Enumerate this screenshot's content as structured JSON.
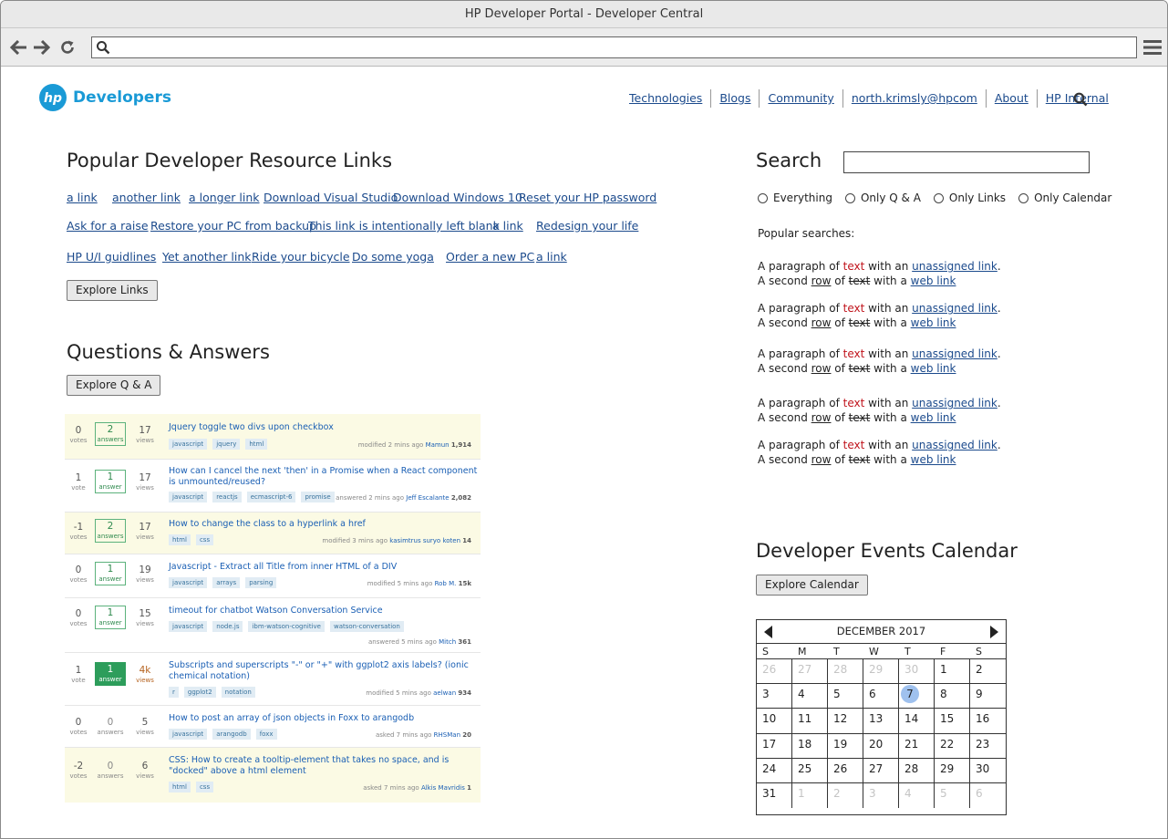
{
  "window": {
    "title": "HP Developer Portal - Developer Central"
  },
  "browser": {
    "address_value": ""
  },
  "header": {
    "logo_text": "Developers",
    "nav": [
      "Technologies",
      "Blogs",
      "Community",
      "north.krimsly@hpcom",
      "About",
      "HP Internal"
    ]
  },
  "resources": {
    "title": "Popular Developer Resource Links",
    "links": [
      "a link",
      "another link",
      "a longer link",
      "Download Visual Studio",
      "Download Windows 10",
      "Reset your HP password",
      "Ask for a raise",
      "Restore your PC from backup",
      "This link is intentionally left blank",
      "a link",
      "Redesign your life",
      "HP U/I guidlines",
      "Yet another link",
      "Ride your bicycle",
      "Do some yoga",
      "Order a new PC",
      "a link"
    ],
    "button": "Explore Links"
  },
  "qa": {
    "title": "Questions & Answers",
    "button": "Explore Q & A",
    "items": [
      {
        "votes": "0",
        "votes_label": "votes",
        "answers": "2",
        "answers_label": "answers",
        "views": "17",
        "views_label": "views",
        "title": "Jquery toggle two divs upon checkbox",
        "tags": [
          "javascript",
          "jquery",
          "html"
        ],
        "meta": "modified 2 mins ago",
        "user": "Mamun",
        "rep": "1,914"
      },
      {
        "votes": "1",
        "votes_label": "vote",
        "answers": "1",
        "answers_label": "answer",
        "views": "17",
        "views_label": "views",
        "title": "How can I cancel the next 'then' in a Promise when a React component is unmounted/reused?",
        "tags": [
          "javascript",
          "reactjs",
          "ecmascript-6",
          "promise"
        ],
        "meta": "answered 2 mins ago",
        "user": "Jeff Escalante",
        "rep": "2,082"
      },
      {
        "votes": "-1",
        "votes_label": "votes",
        "answers": "2",
        "answers_label": "answers",
        "views": "17",
        "views_label": "views",
        "title": "How to change the class to a hyperlink a href",
        "tags": [
          "html",
          "css"
        ],
        "meta": "modified 3 mins ago",
        "user": "kasimtrus suryo koten",
        "rep": "14"
      },
      {
        "votes": "0",
        "votes_label": "votes",
        "answers": "1",
        "answers_label": "answer",
        "views": "19",
        "views_label": "views",
        "title": "Javascript - Extract all Title from inner HTML of a DIV",
        "tags": [
          "javascript",
          "arrays",
          "parsing"
        ],
        "meta": "modified 5 mins ago",
        "user": "Rob M.",
        "rep": "15k"
      },
      {
        "votes": "0",
        "votes_label": "votes",
        "answers": "1",
        "answers_label": "answer",
        "views": "15",
        "views_label": "views",
        "title": "timeout for chatbot Watson Conversation Service",
        "tags": [
          "javascript",
          "node.js",
          "ibm-watson-cognitive",
          "watson-conversation"
        ],
        "meta": "answered 5 mins ago",
        "user": "Mitch",
        "rep": "361"
      },
      {
        "votes": "1",
        "votes_label": "vote",
        "answers": "1",
        "answers_label": "answer",
        "views": "4k",
        "views_label": "views",
        "title": "Subscripts and superscripts \"-\" or \"+\" with ggplot2 axis labels? (ionic chemical notation)",
        "tags": [
          "r",
          "ggplot2",
          "notation"
        ],
        "meta": "modified 5 mins ago",
        "user": "aelwan",
        "rep": "934"
      },
      {
        "votes": "0",
        "votes_label": "votes",
        "answers": "0",
        "answers_label": "answers",
        "views": "5",
        "views_label": "views",
        "title": "How to post an array of json objects in Foxx to arangodb",
        "tags": [
          "javascript",
          "arangodb",
          "foxx"
        ],
        "meta": "asked 7 mins ago",
        "user": "RHSMan",
        "rep": "20"
      },
      {
        "votes": "-2",
        "votes_label": "votes",
        "answers": "0",
        "answers_label": "answers",
        "views": "6",
        "views_label": "views",
        "title": "CSS: How to create a tooltip-element that takes no space, and is \"docked\" above a html element",
        "tags": [
          "html",
          "css"
        ],
        "meta": "asked 7 mins ago",
        "user": "Alkis Mavridis",
        "rep": "1"
      }
    ]
  },
  "search": {
    "title": "Search",
    "value": "",
    "options": [
      "Everything",
      "Only Q & A",
      "Only Links",
      "Only Calendar"
    ],
    "popular_label": "Popular searches:",
    "paragraph": {
      "a": "A paragraph of ",
      "red": "text",
      "b": " with an ",
      "link1": "unassigned link",
      "c": ".",
      "d": "A second ",
      "row": "row",
      "e": " of ",
      "strike": "text",
      "f": " with a ",
      "link2": "web link"
    }
  },
  "calendar": {
    "title": "Developer Events Calendar",
    "button": "Explore Calendar",
    "month": "DECEMBER 2017",
    "dow": [
      "S",
      "M",
      "T",
      "W",
      "T",
      "F",
      "S"
    ],
    "days": [
      "26",
      "27",
      "28",
      "29",
      "30",
      "1",
      "2",
      "3",
      "4",
      "5",
      "6",
      "7",
      "8",
      "9",
      "10",
      "11",
      "12",
      "13",
      "14",
      "15",
      "16",
      "17",
      "18",
      "19",
      "20",
      "21",
      "22",
      "23",
      "24",
      "25",
      "26",
      "27",
      "28",
      "29",
      "30",
      "31",
      "1",
      "2",
      "3",
      "4",
      "5",
      "6"
    ],
    "muted_indices": [
      0,
      1,
      2,
      3,
      4,
      36,
      37,
      38,
      39,
      40,
      41
    ],
    "today_index": 11
  },
  "colors": {
    "accent": "#1a9ad6",
    "link": "#1b4a8c",
    "highlight_text": "#c0141c",
    "today": "#9fc1ee"
  }
}
